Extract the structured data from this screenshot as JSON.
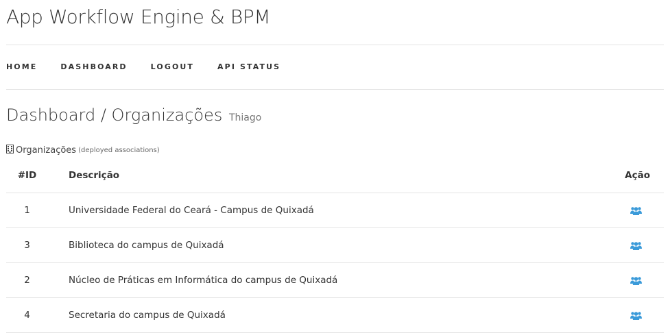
{
  "app": {
    "title": "App Workflow Engine & BPM"
  },
  "nav": {
    "items": [
      {
        "label": "HOME"
      },
      {
        "label": "DASHBOARD"
      },
      {
        "label": "LOGOUT"
      },
      {
        "label": "API STATUS"
      }
    ]
  },
  "page": {
    "title": "Dashboard / Organizações",
    "user": "Thiago"
  },
  "section": {
    "icon": "building-icon",
    "label": "Organizações",
    "sublabel": "(deployed associations)"
  },
  "table": {
    "headers": {
      "id": "#ID",
      "descricao": "Descrição",
      "acao": "Ação"
    },
    "rows": [
      {
        "id": "1",
        "descricao": "Universidade Federal do Ceará - Campus de Quixadá",
        "action_icon": "users-icon"
      },
      {
        "id": "3",
        "descricao": "Biblioteca do campus de Quixadá",
        "action_icon": "users-icon"
      },
      {
        "id": "2",
        "descricao": "Núcleo de Práticas em Informática do campus de Quixadá",
        "action_icon": "users-icon"
      },
      {
        "id": "4",
        "descricao": "Secretaria do campus de Quixadá",
        "action_icon": "users-icon"
      }
    ]
  },
  "colors": {
    "accent": "#3a9ad9",
    "divider": "#e4e4e4",
    "text": "#333333"
  }
}
